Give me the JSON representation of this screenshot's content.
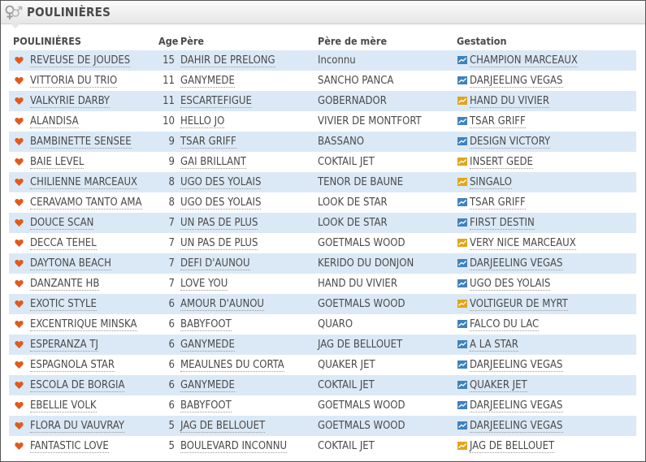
{
  "header": {
    "title": "POULINIÈRES"
  },
  "columns": {
    "name": "POULINIÉRES",
    "age": "Age",
    "pere": "Père",
    "mere": "Père de mère",
    "gestation": "Gestation"
  },
  "colors": {
    "row_alt": "#dbe9f6",
    "heart": "#e05a1e",
    "flag_blue": "#3f82bd",
    "flag_yellow": "#e0a51c"
  },
  "rows": [
    {
      "name": "REVEUSE DE JOUDES",
      "age": "15",
      "pere": "DAHIR DE PRELONG",
      "mere": "Inconnu",
      "gestation": "CHAMPION MARCEAUX",
      "flag": "blue"
    },
    {
      "name": "VITTORIA DU TRIO",
      "age": "11",
      "pere": "GANYMEDE",
      "mere": "SANCHO PANCA",
      "gestation": "DARJEELING VEGAS",
      "flag": "blue"
    },
    {
      "name": "VALKYRIE DARBY",
      "age": "11",
      "pere": "ESCARTEFIGUE",
      "mere": "GOBERNADOR",
      "gestation": "HAND DU VIVIER",
      "flag": "yellow"
    },
    {
      "name": "ALANDISA",
      "age": "10",
      "pere": "HELLO JO",
      "mere": "VIVIER DE MONTFORT",
      "gestation": "TSAR GRIFF",
      "flag": "blue"
    },
    {
      "name": "BAMBINETTE SENSEE",
      "age": "9",
      "pere": "TSAR GRIFF",
      "mere": "BASSANO",
      "gestation": "DESIGN VICTORY",
      "flag": "blue"
    },
    {
      "name": "BAIE LEVEL",
      "age": "9",
      "pere": "GAI BRILLANT",
      "mere": "COKTAIL JET",
      "gestation": "INSERT GEDE",
      "flag": "yellow"
    },
    {
      "name": "CHILIENNE MARCEAUX",
      "age": "8",
      "pere": "UGO DES YOLAIS",
      "mere": "TENOR DE BAUNE",
      "gestation": "SINGALO",
      "flag": "yellow"
    },
    {
      "name": "CERAVAMO TANTO AMA",
      "age": "8",
      "pere": "UGO DES YOLAIS",
      "mere": "LOOK DE STAR",
      "gestation": "TSAR GRIFF",
      "flag": "blue"
    },
    {
      "name": "DOUCE SCAN",
      "age": "7",
      "pere": "UN PAS DE PLUS",
      "mere": "LOOK DE STAR",
      "gestation": "FIRST DESTIN",
      "flag": "blue"
    },
    {
      "name": "DECCA TEHEL",
      "age": "7",
      "pere": "UN PAS DE PLUS",
      "mere": "GOETMALS WOOD",
      "gestation": "VERY NICE MARCEAUX",
      "flag": "yellow"
    },
    {
      "name": "DAYTONA BEACH",
      "age": "7",
      "pere": "DEFI D'AUNOU",
      "mere": "KERIDO DU DONJON",
      "gestation": "DARJEELING VEGAS",
      "flag": "blue"
    },
    {
      "name": "DANZANTE HB",
      "age": "7",
      "pere": "LOVE YOU",
      "mere": "HAND DU VIVIER",
      "gestation": "UGO DES YOLAIS",
      "flag": "blue"
    },
    {
      "name": "EXOTIC STYLE",
      "age": "6",
      "pere": "AMOUR D'AUNOU",
      "mere": "GOETMALS WOOD",
      "gestation": "VOLTIGEUR DE MYRT",
      "flag": "yellow"
    },
    {
      "name": "EXCENTRIQUE MINSKA",
      "age": "6",
      "pere": "BABYFOOT",
      "mere": "QUARO",
      "gestation": "FALCO DU LAC",
      "flag": "blue"
    },
    {
      "name": "ESPERANZA TJ",
      "age": "6",
      "pere": "GANYMEDE",
      "mere": "JAG DE BELLOUET",
      "gestation": "A LA STAR",
      "flag": "blue"
    },
    {
      "name": "ESPAGNOLA STAR",
      "age": "6",
      "pere": "MEAULNES DU CORTA",
      "mere": "QUAKER JET",
      "gestation": "DARJEELING VEGAS",
      "flag": "blue"
    },
    {
      "name": "ESCOLA DE BORGIA",
      "age": "6",
      "pere": "GANYMEDE",
      "mere": "COKTAIL JET",
      "gestation": "QUAKER JET",
      "flag": "blue"
    },
    {
      "name": "EBELLIE VOLK",
      "age": "6",
      "pere": "BABYFOOT",
      "mere": "GOETMALS WOOD",
      "gestation": "DARJEELING VEGAS",
      "flag": "blue"
    },
    {
      "name": "FLORA DU VAUVRAY",
      "age": "5",
      "pere": "JAG DE BELLOUET",
      "mere": "GOETMALS WOOD",
      "gestation": "DARJEELING VEGAS",
      "flag": "blue"
    },
    {
      "name": "FANTASTIC LOVE",
      "age": "5",
      "pere": "BOULEVARD INCONNU",
      "mere": "COKTAIL JET",
      "gestation": "JAG DE BELLOUET",
      "flag": "yellow"
    }
  ]
}
